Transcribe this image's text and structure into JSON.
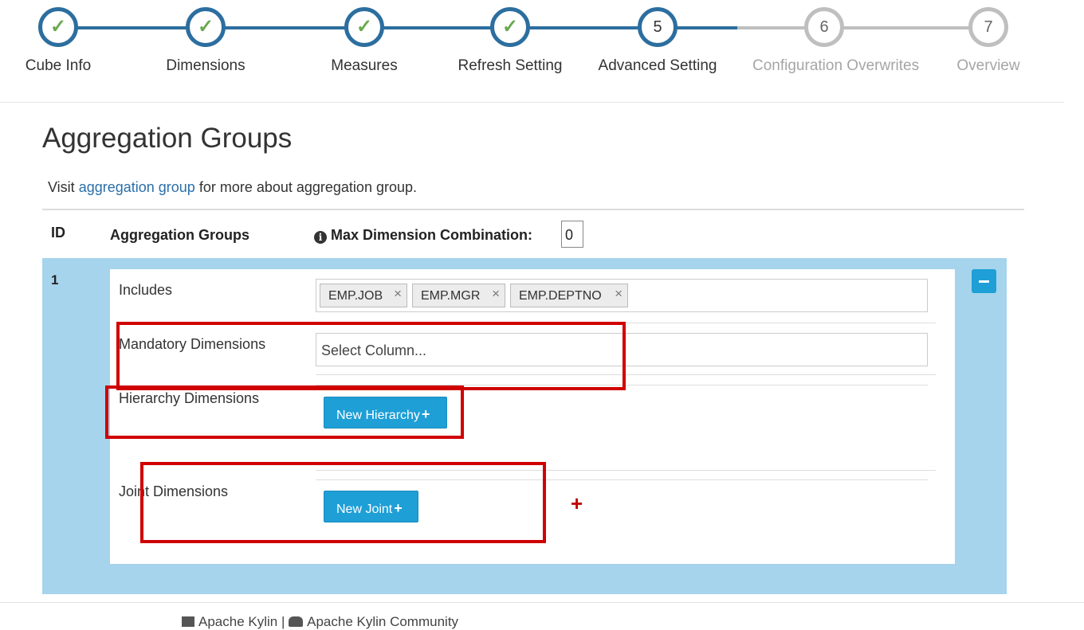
{
  "wizard": {
    "steps": [
      {
        "label": "Cube Info",
        "number": "",
        "state": "done"
      },
      {
        "label": "Dimensions",
        "number": "",
        "state": "done"
      },
      {
        "label": "Measures",
        "number": "",
        "state": "done"
      },
      {
        "label": "Refresh Setting",
        "number": "",
        "state": "done"
      },
      {
        "label": "Advanced Setting",
        "number": "5",
        "state": "current"
      },
      {
        "label": "Configuration Overwrites",
        "number": "6",
        "state": "pending"
      },
      {
        "label": "Overview",
        "number": "7",
        "state": "pending"
      }
    ],
    "check_glyph": "✓",
    "active_color": "#2c6e9f",
    "pending_color": "#bfbfbf",
    "check_color": "#6aa84f"
  },
  "page": {
    "title": "Aggregation Groups",
    "intro_prefix": "Visit ",
    "intro_link": "aggregation group",
    "intro_suffix": " for more about aggregation group."
  },
  "table": {
    "col_id": "ID",
    "col_groups": "Aggregation Groups",
    "max_info_glyph": "i",
    "max_label": "Max Dimension Combination:",
    "max_value": "0"
  },
  "group": {
    "id": "1",
    "includes_label": "Includes",
    "includes": [
      "EMP.JOB",
      "EMP.MGR",
      "EMP.DEPTNO"
    ],
    "tag_remove_glyph": "×",
    "mandatory_label": "Mandatory Dimensions",
    "mandatory_placeholder": "Select Column...",
    "hierarchy_label": "Hierarchy Dimensions",
    "new_hierarchy_label": "New Hierarchy",
    "joint_label": "Joint Dimensions",
    "new_joint_label": "New Joint",
    "plus_glyph": "+",
    "row_bg_color": "#a6d4ec",
    "button_color": "#1e9fd6"
  },
  "annotation": {
    "highlight_color": "#d00000",
    "cursor_glyph": "+"
  },
  "footer": {
    "product_icon": "cube-icon",
    "product": "Apache Kylin",
    "divider": "|",
    "community_icon": "users-icon",
    "community": "Apache Kylin Community"
  }
}
